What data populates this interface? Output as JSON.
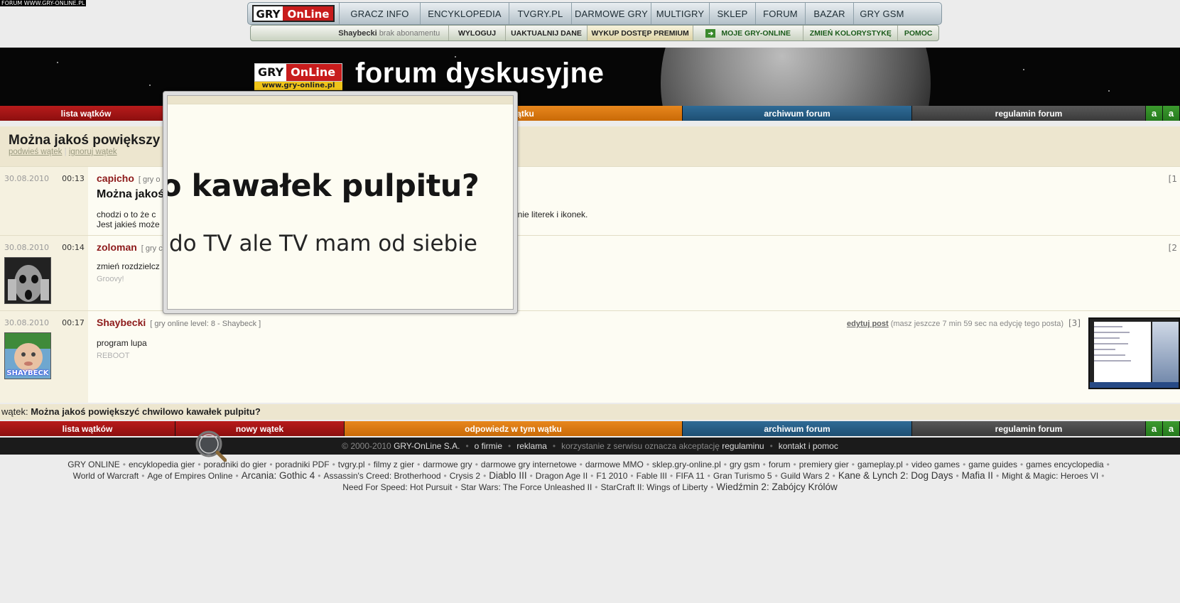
{
  "corner_tag": "FORUM WWW.GRY-ONLINE.PL",
  "logo": {
    "gry": "GRY",
    "online": "OnLine",
    "url": "www.gry-online.pl"
  },
  "topnav": [
    "GRACZ INFO",
    "ENCYKLOPEDIA",
    "TVGRY.PL",
    "DARMOWE GRY",
    "MULTIGRY",
    "SKLEP",
    "FORUM",
    "BAZAR",
    "GRY GSM"
  ],
  "subnav": {
    "username": "Shaybecki",
    "subscription": "brak abonamentu",
    "items": [
      "WYLOGUJ",
      "UAKTUALNIJ DANE",
      "WYKUP DOSTĘP PREMIUM",
      "MOJE GRY-ONLINE",
      "ZMIEŃ KOLORYSTYKĘ",
      "POMOC"
    ]
  },
  "banner_title": "forum dyskusyjne",
  "menu_top": [
    "lista wątków",
    "tym wątku",
    "archiwum forum",
    "regulamin forum"
  ],
  "menu_bottom": [
    "lista wątków",
    "nowy wątek",
    "odpowiedz w tym wątku",
    "archiwum forum",
    "regulamin forum"
  ],
  "font_buttons": [
    "a",
    "a"
  ],
  "thread": {
    "title_fragment": "Można jakoś powiększy",
    "action_1": "podwieś wątek",
    "action_2": "ignoruj wątek",
    "full_title": "Można jakoś powiększyć chwilowo kawałek pulpitu?",
    "label": "wątek:"
  },
  "posts": [
    {
      "date": "30.08.2010",
      "time": "00:13",
      "author": "capicho",
      "level": "[ gry o",
      "subject": "Można jakoś",
      "body_1": "chodzi o to że c",
      "body_1_end": "dnie literek i ikonek.",
      "body_2": "Jest jakieś może",
      "number": "[1"
    },
    {
      "date": "30.08.2010",
      "time": "00:14",
      "author": "zoloman",
      "level": "[ gry c",
      "body_1": "zmień rozdzielcz",
      "signature": "Groovy!",
      "number": "[2"
    },
    {
      "date": "30.08.2010",
      "time": "00:17",
      "author": "Shaybecki",
      "level": "[ gry online level: 8 - Shaybeck ]",
      "body_1": "program lupa",
      "signature": "REBOOT",
      "edit_link": "edytuj post",
      "edit_note": "(masz jeszcze 7 min 59 sec na edycję tego posta)",
      "number": "[3]",
      "avatar_text": "SHAYBECK"
    }
  ],
  "magnifier": {
    "line_1": "o kawałek pulpitu?",
    "line_2": "do TV ale TV mam od siebie"
  },
  "copyright": {
    "c": "© 2000-2010",
    "company": "GRY-OnLine S.A.",
    "o_firmie": "o firmie",
    "reklama": "reklama",
    "note": "korzystanie z serwisu oznacza akceptację",
    "regulamin": "regulaminu",
    "kontakt": "kontakt i pomoc"
  },
  "footer_links": [
    [
      "GRY ONLINE",
      "encyklopedia gier",
      "poradniki do gier",
      "poradniki PDF",
      "tvgry.pl",
      "filmy z gier",
      "darmowe gry",
      "darmowe gry internetowe",
      "darmowe MMO",
      "sklep.gry-online.pl",
      "gry gsm",
      "forum",
      "premiery gier",
      "gameplay.pl",
      "video games",
      "game guides",
      "games encyclopedia"
    ],
    [
      "World of Warcraft",
      "Age of Empires Online",
      "Arcania: Gothic 4",
      "Assassin's Creed: Brotherhood",
      "Crysis 2",
      "Diablo III",
      "Dragon Age II",
      "F1 2010",
      "Fable III",
      "FIFA 11",
      "Gran Turismo 5",
      "Guild Wars 2",
      "Kane & Lynch 2: Dog Days",
      "Mafia II",
      "Might & Magic: Heroes VI"
    ],
    [
      "Need For Speed: Hot Pursuit",
      "Star Wars: The Force Unleashed II",
      "StarCraft II: Wings of Liberty",
      "Wiedźmin 2: Zabójcy Królów"
    ]
  ],
  "colors": {
    "brand_red": "#c81c1c",
    "orange": "#e8871d",
    "blue": "#2f6b96",
    "author": "#8d1a1a"
  }
}
